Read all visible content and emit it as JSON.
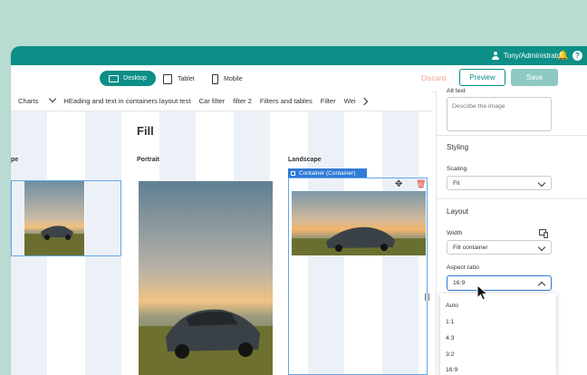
{
  "topbar": {
    "user": "Tony/Administrator",
    "user_icon": "person-icon",
    "bell_icon": "bell-icon",
    "help_icon": "help-icon",
    "help_glyph": "?"
  },
  "devices": {
    "desktop": "Desktop",
    "tablet": "Tablet",
    "mobile": "Mobile"
  },
  "actions": {
    "discard": "Discard",
    "preview": "Preview",
    "save": "Save"
  },
  "tabs": [
    "Charts",
    "HEading and text in containers layout test",
    "Car filter",
    "filter 2",
    "Filters and tables",
    "Filter",
    "Wei"
  ],
  "canvas": {
    "fill_title": "Fill",
    "section_left": "pe",
    "section_portrait": "Portrait",
    "section_landscape": "Landscape",
    "container_tag": "Container (Container)"
  },
  "panel": {
    "alt_text_label": "Alt text",
    "alt_text_placeholder": "Describe the image",
    "styling_heading": "Styling",
    "scaling_label": "Scaling",
    "scaling_value": "Fit",
    "layout_heading": "Layout",
    "width_label": "Width",
    "width_value": "Fill container",
    "aspect_label": "Aspect ratio",
    "aspect_value": "16:9",
    "aspect_options": [
      "Auto",
      "1:1",
      "4:3",
      "3:2",
      "16:9"
    ]
  },
  "colors": {
    "background": "#b9dcd2",
    "teal": "#0b8f87",
    "save_disabled": "#8ec8c3",
    "discard": "#f0a48c",
    "selection_blue": "#2f7ad6",
    "delete_red": "#d9342b"
  }
}
